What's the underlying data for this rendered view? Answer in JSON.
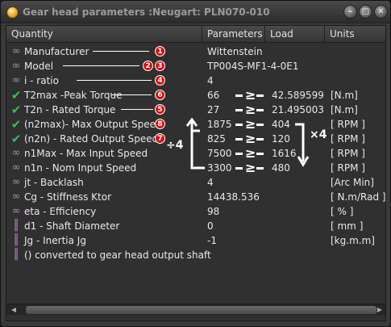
{
  "window": {
    "title": "Gear head parameters :Neugart: PLN070-010",
    "buttons": {
      "minimize": "–",
      "maximize": "□",
      "close": "✕"
    }
  },
  "table": {
    "columns": [
      "Quantity",
      "Parameters",
      "Load",
      "Units"
    ],
    "rows": [
      {
        "icon": "link-icon",
        "quantity": "Manufacturer",
        "parameter": "Wittenstein",
        "load": "",
        "unit": ""
      },
      {
        "icon": "link-icon",
        "quantity": "Model",
        "parameter": "TP004S-MF1-4-0E1",
        "load": "",
        "unit": ""
      },
      {
        "icon": "link-icon",
        "quantity": "i - ratio",
        "parameter": "4",
        "load": "",
        "unit": ""
      },
      {
        "icon": "check-icon",
        "quantity": "T2max -Peak Torque",
        "parameter": "66",
        "load": "42.589599",
        "unit": "[N.m]"
      },
      {
        "icon": "check-icon",
        "quantity": "T2n   - Rated Torque",
        "parameter": "27",
        "load": "21.495003",
        "unit": "[N.m]"
      },
      {
        "icon": "check-icon",
        "quantity": "(n2max)- Max Output Speed",
        "parameter": "1875",
        "load": "404",
        "unit": "[ RPM ]"
      },
      {
        "icon": "check-icon",
        "quantity": "(n2n) - Rated Output Speed",
        "parameter": "825",
        "load": "120",
        "unit": "[ RPM ]"
      },
      {
        "icon": "link-icon",
        "quantity": "n1Max - Max Input Speed",
        "parameter": "7500",
        "load": "1616",
        "unit": "[ RPM ]"
      },
      {
        "icon": "link-icon",
        "quantity": "n1n    - Nom Input Speed",
        "parameter": "3300",
        "load": "480",
        "unit": "[ RPM ]"
      },
      {
        "icon": "link-icon",
        "quantity": "jt    - Backlash",
        "parameter": "4",
        "load": "",
        "unit": "[Arc Min]"
      },
      {
        "icon": "link-icon",
        "quantity": "Cg    - Stiffness Ktor",
        "parameter": "14438.536",
        "load": "",
        "unit": "[ N.m/Rad ]"
      },
      {
        "icon": "link-icon",
        "quantity": "eta    - Efficiency",
        "parameter": "98",
        "load": "",
        "unit": "[ % ]"
      },
      {
        "icon": "bars-icon",
        "quantity": "d1     - Shaft Diameter",
        "parameter": "0",
        "load": "",
        "unit": "[ mm ]"
      },
      {
        "icon": "bars-icon",
        "quantity": "Jg     - Inertia Jg",
        "parameter": "-1",
        "load": "",
        "unit": "[kg.m.m]"
      },
      {
        "icon": "bars-icon",
        "quantity": "() converted to gear head output shaft",
        "parameter": "",
        "load": "",
        "unit": ""
      }
    ]
  },
  "annotations": {
    "badges": [
      "1",
      "2",
      "3",
      "4",
      "6",
      "5",
      "8",
      "7"
    ],
    "gte_symbol": "≥",
    "divide_label": "÷4",
    "multiply_label": "×4"
  },
  "colors": {
    "badge": "#e01010",
    "check": "#33c24d",
    "bars_icon": "#c77dd6"
  }
}
